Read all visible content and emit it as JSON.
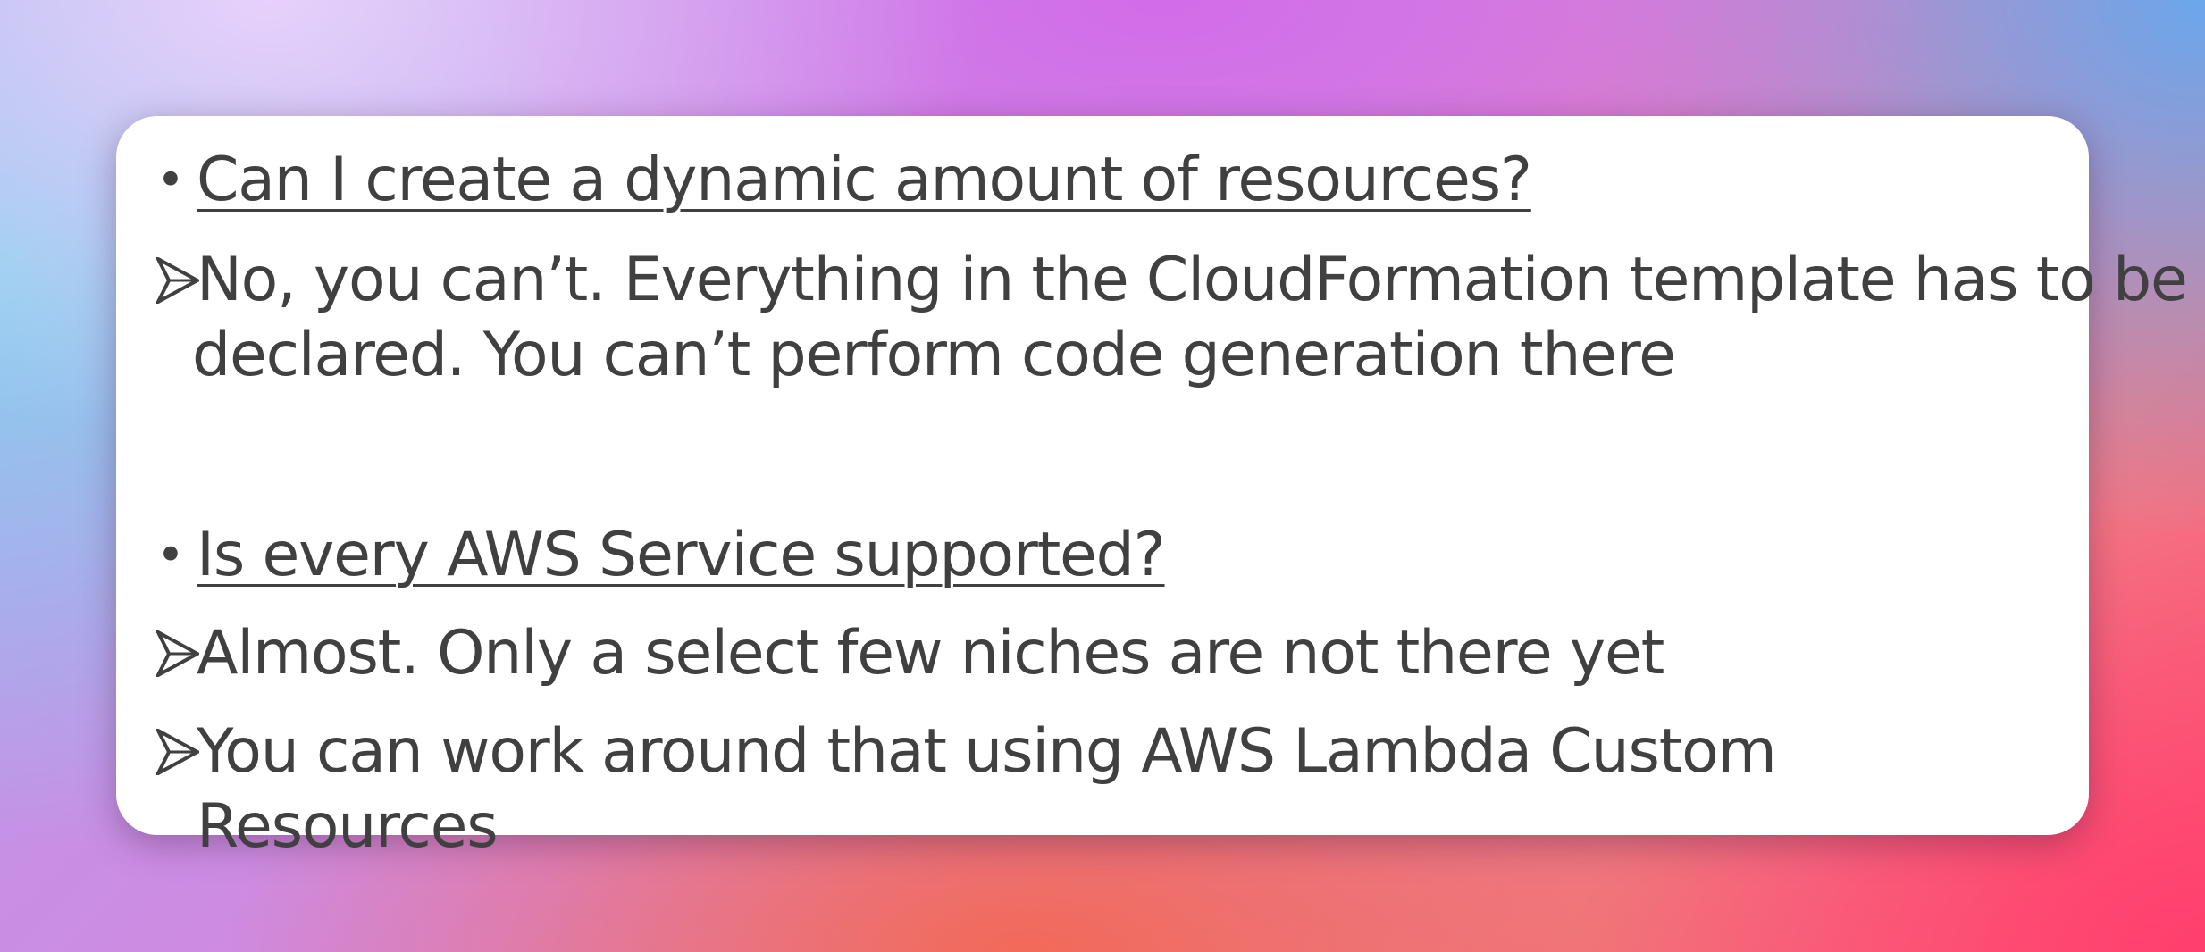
{
  "slide": {
    "items": [
      {
        "type": "question",
        "text": "Can I create a dynamic amount of resources?"
      },
      {
        "type": "answer",
        "line1": "No, you can’t. Everything in the CloudFormation template has to be",
        "line2": "declared. You can’t perform code generation there"
      },
      {
        "type": "question",
        "text": "Is every AWS Service supported?"
      },
      {
        "type": "answer",
        "line1": "Almost. Only a select few niches are not there yet"
      },
      {
        "type": "answer",
        "line1": "You can work around that using AWS Lambda Custom Resources"
      }
    ]
  },
  "icons": {
    "bullet": "bullet-dot-icon",
    "answer": "arrowhead-right-icon"
  }
}
